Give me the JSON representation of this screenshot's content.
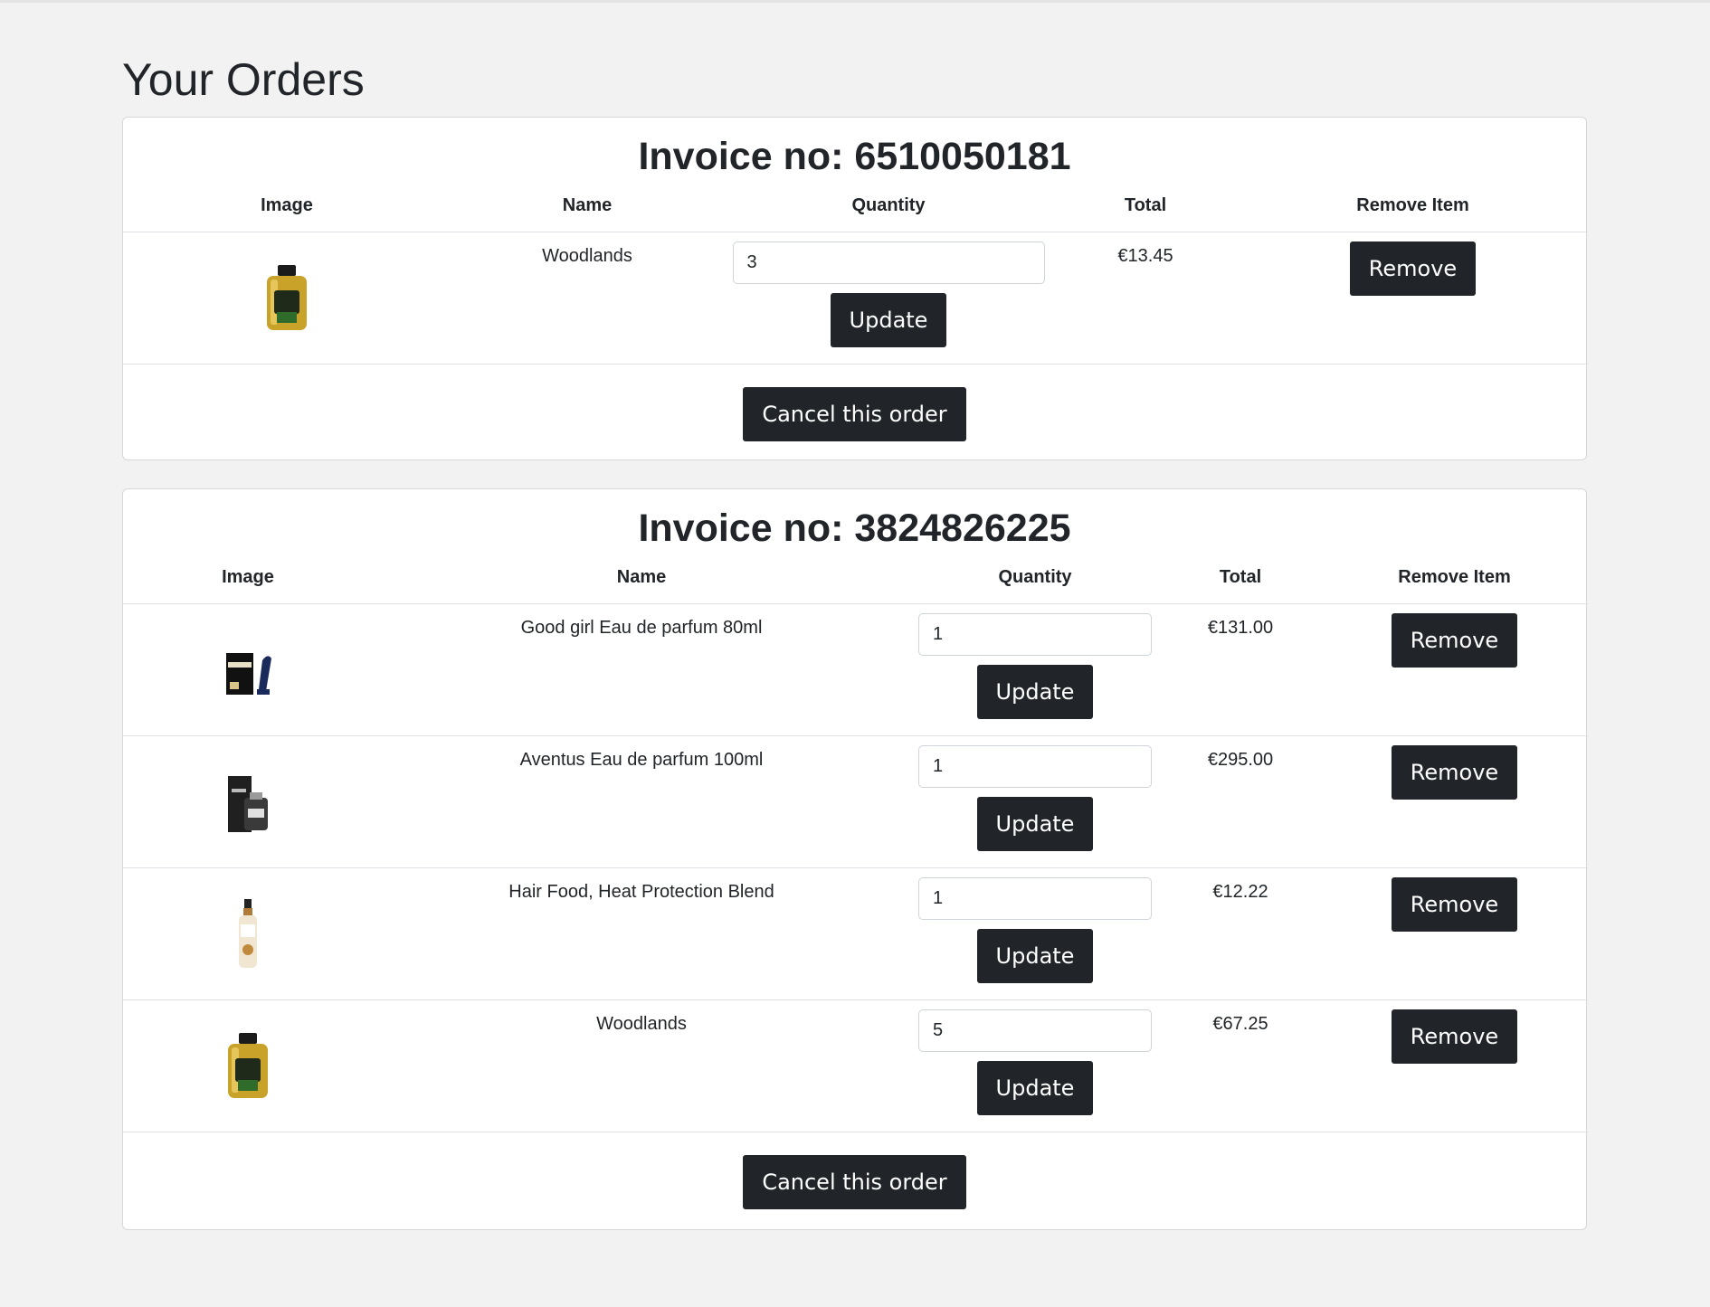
{
  "page": {
    "title": "Your Orders"
  },
  "labels": {
    "col_image": "Image",
    "col_name": "Name",
    "col_quantity": "Quantity",
    "col_total": "Total",
    "col_remove": "Remove Item",
    "update_button": "Update",
    "remove_button": "Remove",
    "cancel_button": "Cancel this order"
  },
  "orders": [
    {
      "invoice": "Invoice no: 6510050181",
      "items": [
        {
          "image": "bottle-gold-icon",
          "name": "Woodlands",
          "quantity": "3",
          "total": "€13.45"
        }
      ]
    },
    {
      "invoice": "Invoice no: 3824826225",
      "items": [
        {
          "image": "perfume-box-heel-icon",
          "name": "Good girl Eau de parfum 80ml",
          "quantity": "1",
          "total": "€131.00"
        },
        {
          "image": "perfume-box-black-icon",
          "name": "Aventus Eau de parfum 100ml",
          "quantity": "1",
          "total": "€295.00"
        },
        {
          "image": "spray-bottle-icon",
          "name": "Hair Food, Heat Protection Blend",
          "quantity": "1",
          "total": "€12.22"
        },
        {
          "image": "bottle-gold-icon",
          "name": "Woodlands",
          "quantity": "5",
          "total": "€67.25"
        }
      ]
    }
  ],
  "colors": {
    "background": "#f2f2f2",
    "card": "#ffffff",
    "button_dark": "#212529",
    "button_text": "#ffffff"
  }
}
